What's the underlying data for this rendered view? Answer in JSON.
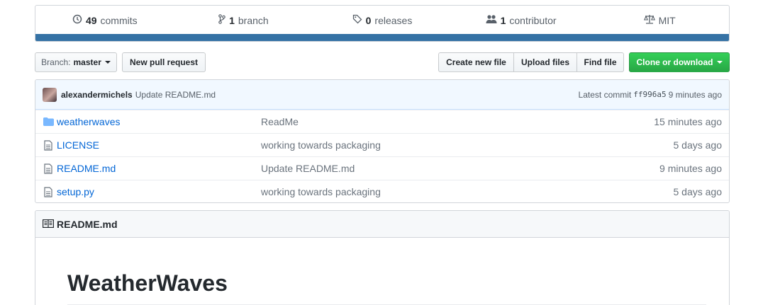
{
  "summary": {
    "commits": {
      "count": "49",
      "label": "commits",
      "icon": "history-icon"
    },
    "branches": {
      "count": "1",
      "label": "branch",
      "icon": "git-branch-icon"
    },
    "releases": {
      "count": "0",
      "label": "releases",
      "icon": "tag-icon"
    },
    "contributors": {
      "count": "1",
      "label": "contributor",
      "icon": "people-icon"
    },
    "license": {
      "label": "MIT",
      "icon": "law-icon"
    },
    "language_color": "#3572A5"
  },
  "toolbar": {
    "branch_prefix": "Branch:",
    "branch_name": "master",
    "new_pr": "New pull request",
    "create_file": "Create new file",
    "upload_files": "Upload files",
    "find_file": "Find file",
    "clone": "Clone or download"
  },
  "commit": {
    "author": "alexandermichels",
    "message": "Update README.md",
    "latest_label": "Latest commit",
    "sha": "ff996a5",
    "age": "9 minutes ago"
  },
  "files": [
    {
      "name": "weatherwaves",
      "type": "dir",
      "message": "ReadMe",
      "age": "15 minutes ago"
    },
    {
      "name": "LICENSE",
      "type": "file",
      "message": "working towards packaging",
      "age": "5 days ago"
    },
    {
      "name": "README.md",
      "type": "file",
      "message": "Update README.md",
      "age": "9 minutes ago"
    },
    {
      "name": "setup.py",
      "type": "file",
      "message": "working towards packaging",
      "age": "5 days ago"
    }
  ],
  "readme": {
    "header": "README.md",
    "title": "WeatherWaves"
  },
  "colors": {
    "link": "#0366d6",
    "clone_button": "#28a745",
    "commit_bar": "#f1f8ff"
  }
}
